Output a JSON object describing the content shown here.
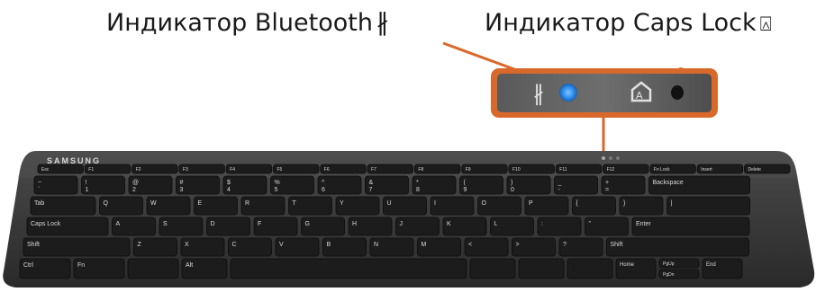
{
  "callouts": {
    "bluetooth": {
      "text": "Индикатор Bluetooth",
      "icon": "bluetooth-icon",
      "icon_glyph": "∦"
    },
    "caps_lock": {
      "text": "Индикатор Caps Lock",
      "icon": "caps-lock-icon",
      "icon_glyph": "⍓"
    }
  },
  "keyboard": {
    "brand": "SAMSUNG",
    "fn_row": [
      "Esc",
      "F1",
      "F2",
      "F3",
      "F4",
      "F5",
      "F6",
      "F7",
      "F8",
      "F9",
      "F10",
      "F11",
      "F12",
      "Fn Lock",
      "Insert",
      "Delete"
    ],
    "number_row": [
      "~",
      "!",
      "@",
      "#",
      "$",
      "%",
      "^",
      "&",
      "*",
      "(",
      ")",
      "_",
      "+",
      "Backspace"
    ],
    "number_row_digits": [
      "`",
      "1",
      "2",
      "3",
      "4",
      "5",
      "6",
      "7",
      "8",
      "9",
      "0",
      "-",
      "="
    ],
    "top_row": [
      "Tab",
      "Q",
      "W",
      "E",
      "R",
      "T",
      "Y",
      "U",
      "I",
      "O",
      "P",
      "{",
      "}",
      "|"
    ],
    "home_row": [
      "Caps Lock",
      "A",
      "S",
      "D",
      "F",
      "G",
      "H",
      "J",
      "K",
      "L",
      ":",
      "\"",
      "Enter"
    ],
    "bottom_row": [
      "Shift",
      "Z",
      "X",
      "C",
      "V",
      "B",
      "N",
      "M",
      "<",
      ">",
      "?",
      "Shift"
    ],
    "space_row": [
      "Ctrl",
      "Fn",
      "Alt",
      "Home",
      "End",
      "PgUp",
      "PgDn"
    ]
  },
  "colors": {
    "accent": "#d9692b",
    "bluetooth_led": "#2f8ff0",
    "keyboard_body": "#3a3a3a",
    "key_face": "#1c1c1c"
  }
}
